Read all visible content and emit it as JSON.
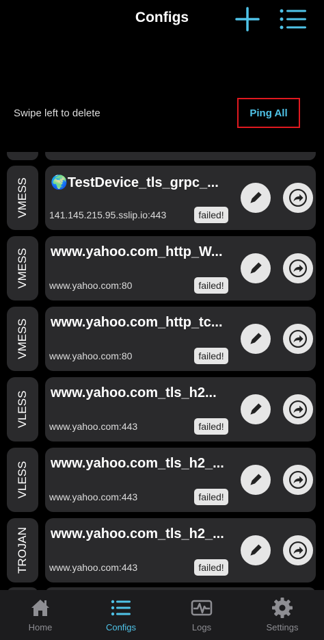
{
  "header": {
    "title": "Configs"
  },
  "hint": "Swipe left to delete",
  "ping_all_label": "Ping All",
  "configs": [
    {
      "protocol": "VMESS",
      "name": "TestDevice_tls_grpc_...",
      "flag": "🌍",
      "address": "141.145.215.95.sslip.io:443",
      "status": "failed!"
    },
    {
      "protocol": "VMESS",
      "name": "www.yahoo.com_http_W...",
      "flag": "",
      "address": "www.yahoo.com:80",
      "status": "failed!"
    },
    {
      "protocol": "VMESS",
      "name": "www.yahoo.com_http_tc...",
      "flag": "",
      "address": "www.yahoo.com:80",
      "status": "failed!"
    },
    {
      "protocol": "VLESS",
      "name": "www.yahoo.com_tls_h2...",
      "flag": "",
      "address": "www.yahoo.com:443",
      "status": "failed!"
    },
    {
      "protocol": "VLESS",
      "name": "www.yahoo.com_tls_h2_...",
      "flag": "",
      "address": "www.yahoo.com:443",
      "status": "failed!"
    },
    {
      "protocol": "TROJAN",
      "name": "www.yahoo.com_tls_h2_...",
      "flag": "",
      "address": "www.yahoo.com:443",
      "status": "failed!"
    }
  ],
  "tabs": [
    {
      "label": "Home",
      "icon": "home-icon",
      "active": false
    },
    {
      "label": "Configs",
      "icon": "list-icon",
      "active": true
    },
    {
      "label": "Logs",
      "icon": "pulse-icon",
      "active": false
    },
    {
      "label": "Settings",
      "icon": "gear-icon",
      "active": false
    }
  ],
  "colors": {
    "accent": "#4fc3e8",
    "highlight_border": "#e0191f",
    "card": "#2a2a2c",
    "tabbar": "#1c1c1e"
  }
}
